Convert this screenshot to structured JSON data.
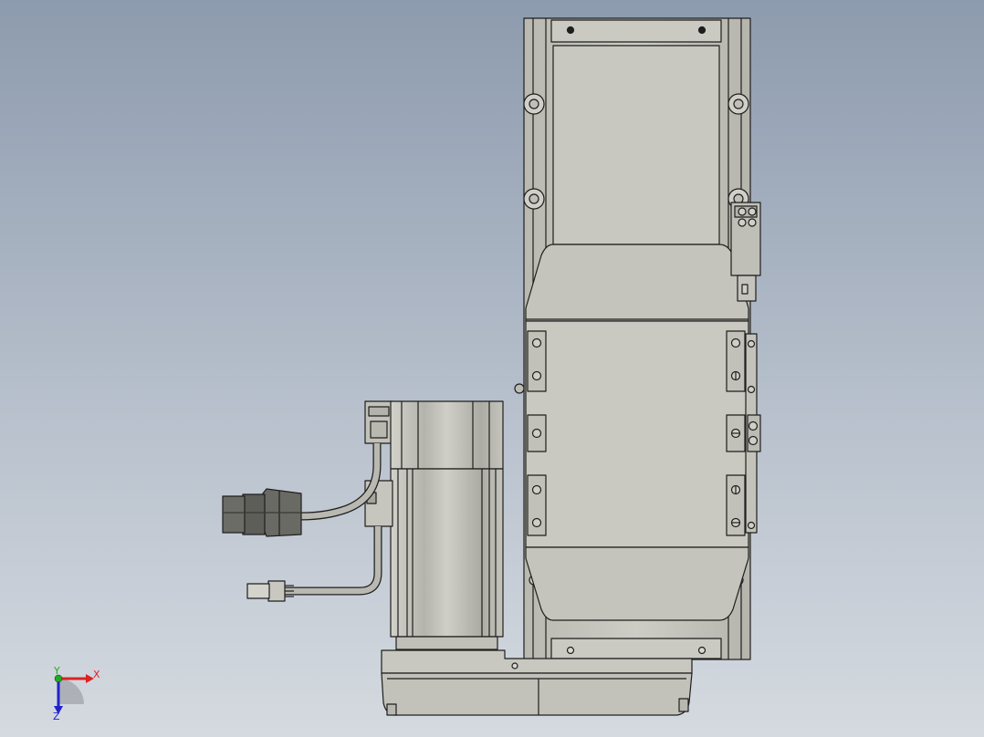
{
  "viewport": {
    "background_top": "#8d9bae",
    "background_bottom": "#d5dae0"
  },
  "model": {
    "name": "linear-actuator-with-servo-motor",
    "body_color": "#c6c6be",
    "shade_color": "#aeaea6",
    "edge_color": "#1e1e1e",
    "connector_color": "#5e5e58"
  },
  "triad": {
    "x_label": "X",
    "y_label": "Y",
    "z_label": "Z",
    "x_color": "#dd2222",
    "y_color": "#22aa22",
    "z_color": "#2222cc"
  }
}
